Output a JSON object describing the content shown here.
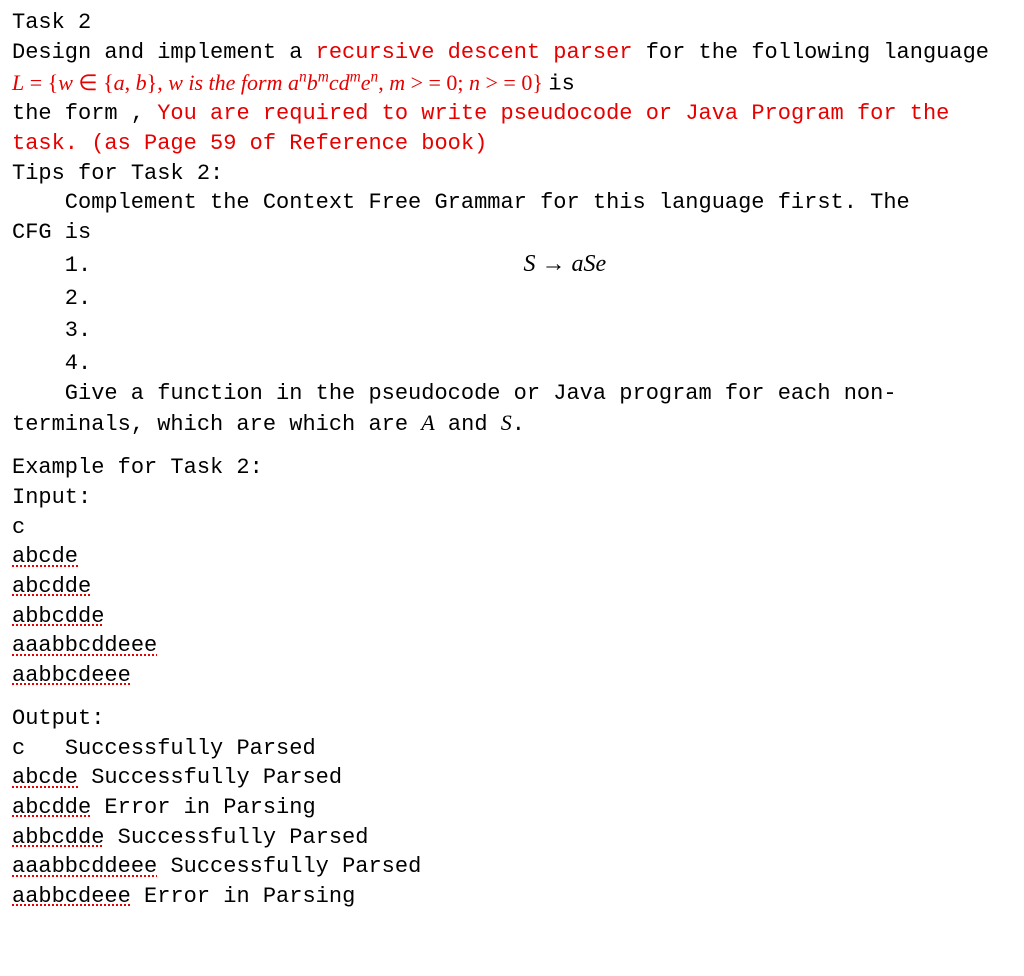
{
  "title": "Task 2",
  "line1_a": "Design and implement a ",
  "line1_b": "recursive descent parser",
  "line1_c": " for the following language",
  "formula": {
    "L": "L",
    "eq1": " = {",
    "w": "w",
    "in": " ∈ {",
    "a": "a",
    "comma1": ", ",
    "b": "b",
    "close1": "}, ",
    "phrase": "w is the form ",
    "an": "a",
    "sup_n1": "n",
    "bm": "b",
    "sup_m1": "m",
    "c": "c",
    "dm": "d",
    "sup_m2": "m",
    "en": "e",
    "sup_n2": "n",
    "comma2": ", ",
    "m": "m",
    "ge1": " > = 0; ",
    "n": "n",
    "ge2": " > = 0}",
    "trail": " is"
  },
  "line3_a": "the form , ",
  "line3_b": "You are required to write pseudocode or Java Program for the task. (as Page 59 of Reference book)",
  "tips_head": "Tips for Task 2:",
  "tips_text": "Complement the Context Free Grammar for this language first. The",
  "cfg_is": "CFG is",
  "rules": [
    {
      "num": "1.",
      "body_l": "S",
      "body_arrow": " → ",
      "body_r": "aSe"
    },
    {
      "num": "2.",
      "body_l": "",
      "body_arrow": "",
      "body_r": ""
    },
    {
      "num": "3.",
      "body_l": "",
      "body_arrow": "",
      "body_r": ""
    },
    {
      "num": "4.",
      "body_l": "",
      "body_arrow": "",
      "body_r": ""
    }
  ],
  "tips2_a": "Give a function in the pseudocode or Java program for each non-",
  "tips2_b": "terminals, which are which are ",
  "A": "A",
  "and": " and ",
  "S": "S",
  "period": ".",
  "example_head": "Example for Task 2:",
  "input_label": "Input:",
  "inputs": [
    {
      "t": "c",
      "spell": false
    },
    {
      "t": "abcde",
      "spell": true
    },
    {
      "t": "abcdde",
      "spell": true
    },
    {
      "t": "abbcdde",
      "spell": true
    },
    {
      "t": "aaabbcddeee",
      "spell": true
    },
    {
      "t": "aabbcdeee",
      "spell": true
    }
  ],
  "output_label": "Output:",
  "outputs": [
    {
      "w": "c",
      "spell": false,
      "sep": "   ",
      "r": "Successfully Parsed"
    },
    {
      "w": "abcde",
      "spell": true,
      "sep": " ",
      "r": "Successfully Parsed"
    },
    {
      "w": "abcdde",
      "spell": true,
      "sep": " ",
      "r": "Error in Parsing"
    },
    {
      "w": "abbcdde",
      "spell": true,
      "sep": " ",
      "r": "Successfully Parsed"
    },
    {
      "w": "aaabbcddeee",
      "spell": true,
      "sep": " ",
      "r": "Successfully Parsed"
    },
    {
      "w": "aabbcdeee",
      "spell": true,
      "sep": " ",
      "r": "Error in Parsing"
    }
  ]
}
